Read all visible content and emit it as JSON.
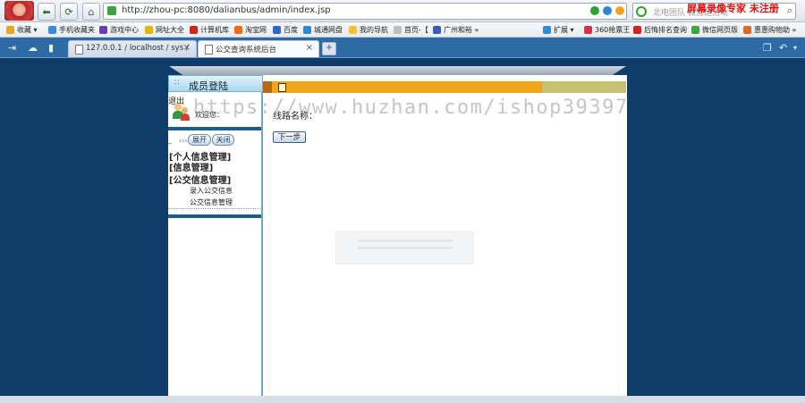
{
  "browser": {
    "address_url": "http://zhou-pc:8080/dalianbus/admin/index.jsp",
    "search_placeholder": "北电团队 微营运活动",
    "watermark": "屏幕录像专家 未注册"
  },
  "bookmarks": [
    {
      "label": "收藏",
      "color": "#e6a817"
    },
    {
      "label": "手机收藏夹",
      "color": "#3a8be0"
    },
    {
      "label": "游戏中心",
      "color": "#6a3db8"
    },
    {
      "label": "网址大全",
      "color": "#e4b510"
    },
    {
      "label": "计算机库",
      "color": "#d0261f"
    },
    {
      "label": "淘宝网",
      "color": "#f06a1b"
    },
    {
      "label": "百度",
      "color": "#2f65c9"
    },
    {
      "label": "城通网盘",
      "color": "#2f8ad6"
    },
    {
      "label": "我的导航",
      "color": "#f2c233"
    },
    {
      "label": "首页-【",
      "color": "#bfbfbf"
    },
    {
      "label": "广州和裕",
      "color": "#3a5bb0"
    },
    {
      "label": "扩展",
      "color": "#2f8ad6"
    },
    {
      "label": "360抢票王",
      "color": "#d9304a"
    },
    {
      "label": "后悔排名查询",
      "color": "#d0261f"
    },
    {
      "label": "微信网页版",
      "color": "#3aab3a"
    },
    {
      "label": "惠惠购物助",
      "color": "#e06a1b"
    }
  ],
  "tabs": [
    {
      "title": "127.0.0.1 / localhost / sys /",
      "close": "×"
    },
    {
      "title": "公交查询系统后台",
      "close": "×"
    }
  ],
  "newtab": "+",
  "sidebar": {
    "header": "成员登陆",
    "logout": "退出",
    "welcome": "欢迎您：",
    "arrows": "›››",
    "expand": "展开",
    "collapse": "关闭",
    "menu": [
      {
        "label": "[个人信息管理]"
      },
      {
        "label": "[信息管理]"
      },
      {
        "label": "[公交信息管理]"
      }
    ],
    "submenu": [
      {
        "label": "录入公交信息"
      },
      {
        "label": "公交信息管理"
      }
    ]
  },
  "main": {
    "route_label": "线路名称：",
    "next_button": "下一步",
    "overlay_url": "https://www.huzhan.com/ishop39397"
  }
}
